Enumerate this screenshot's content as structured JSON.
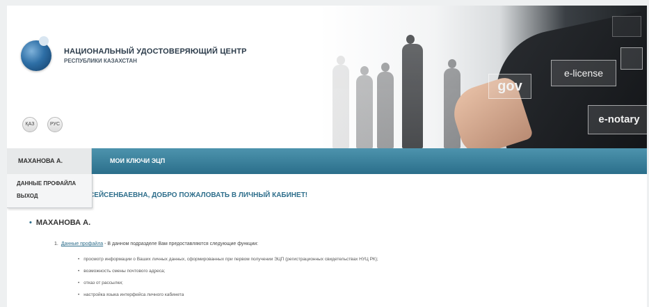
{
  "header": {
    "org_name": "НАЦИОНАЛЬНЫЙ УДОСТОВЕРЯЮЩИЙ ЦЕНТР",
    "org_sub": "РЕСПУБЛИКИ КАЗАХСТАН",
    "lang_buttons": [
      "ҚАЗ",
      "РУС"
    ],
    "banner_labels": {
      "gov": "gov",
      "license": "e-license",
      "notary": "e-notary"
    }
  },
  "nav": {
    "user_tab": "МАХАНОВА А.",
    "keys_tab": "МОИ КЛЮЧИ ЭЦП"
  },
  "dropdown": {
    "items": [
      "ДАННЫЕ ПРОФАЙЛА",
      "ВЫХОД"
    ]
  },
  "content": {
    "welcome": "МАХАНОВА АЙГУЛЬ СЕЙСЕНБАЕВНА, ДОБРО ПОЖАЛОВАТЬ В ЛИЧНЫЙ КАБИНЕТ!",
    "section_title": "МАХАНОВА А.",
    "intro_number": "1.",
    "intro_link": "Данные профайла",
    "intro_text": " - В данном подразделе Вам предоставляются следующие функции:",
    "functions": [
      "просмотр информации о Ваших личных данных, сформированных при первом получении ЭЦП (регистрационных свидетельствах НУЦ РК);",
      "возможность смены почтового адреса;",
      "отказ от рассылки;",
      "настройка языка интерфейса личного кабинета"
    ]
  },
  "colors": {
    "nav_bar": "#3a81a0",
    "accent_text": "#2f6f8c",
    "page_background": "#eef0f1"
  },
  "icons": {
    "logo": "globe-logo-icon",
    "bullet": "bullet-icon"
  }
}
